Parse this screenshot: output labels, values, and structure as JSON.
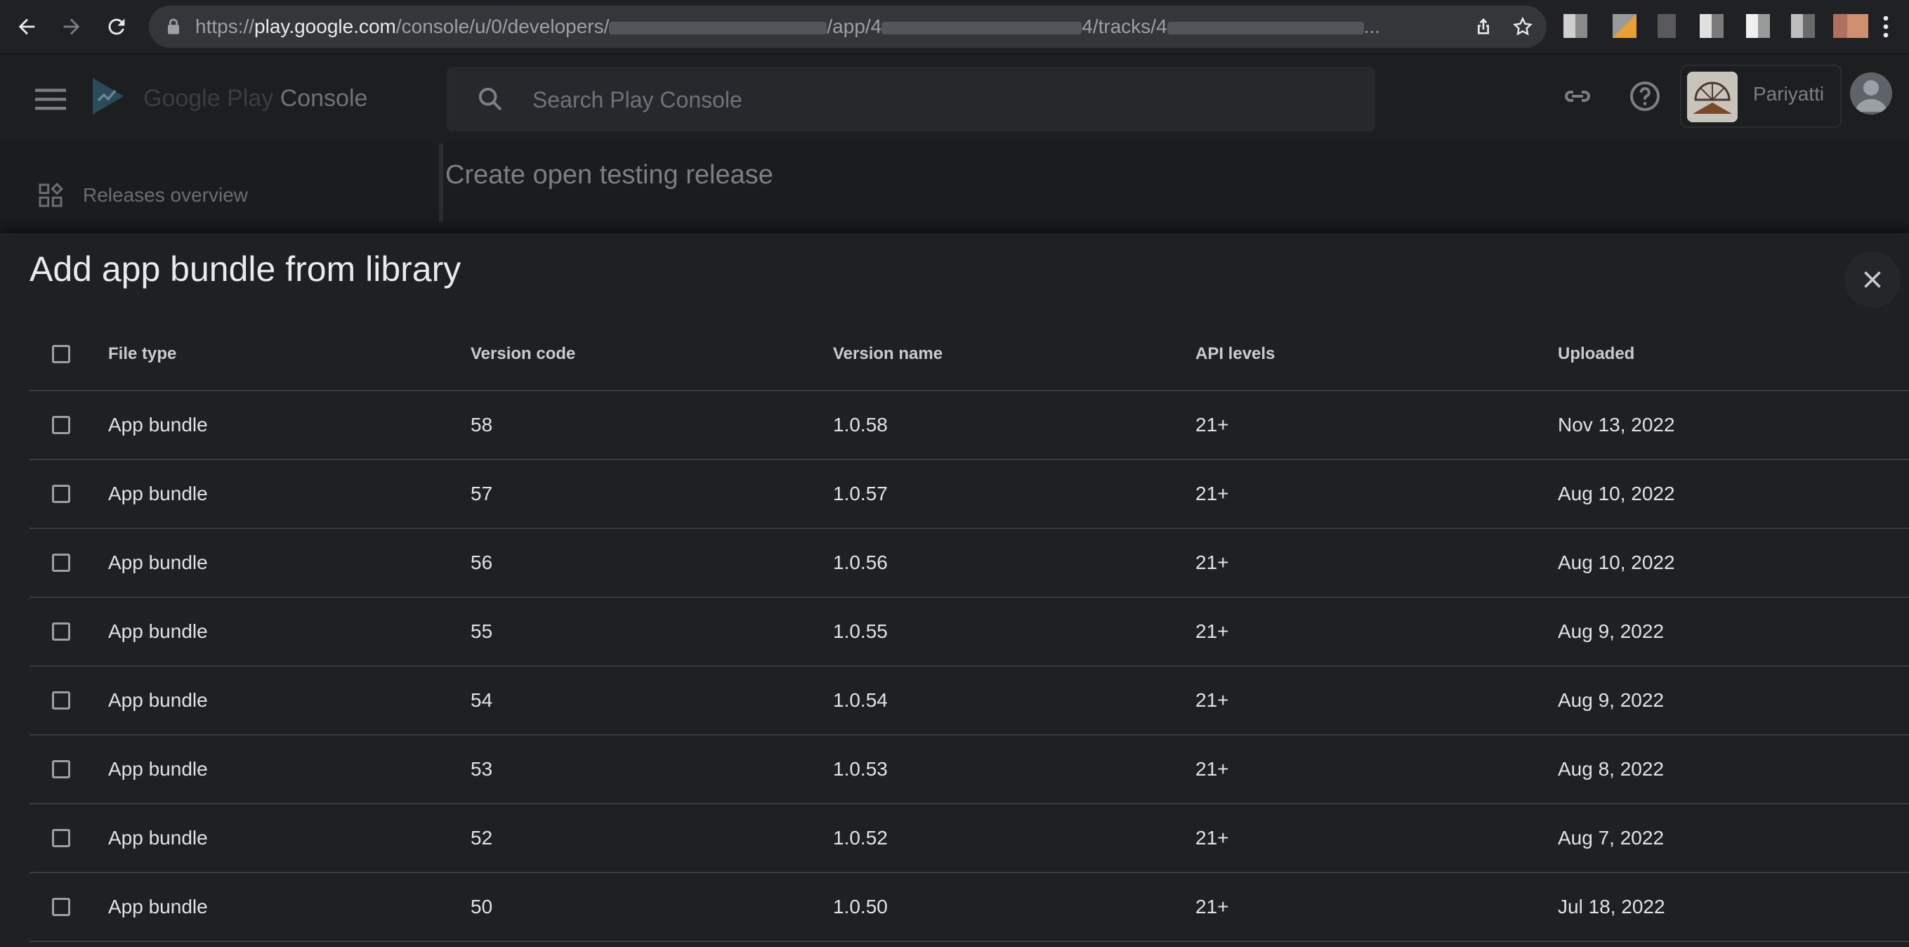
{
  "browser": {
    "url_scheme": "https://",
    "url_host": "play.google.com",
    "url_path_1": "/console/u/0/developers/",
    "url_path_2": "/app/4",
    "url_path_3": "4/tracks/4",
    "url_ellipsis": "..."
  },
  "header": {
    "brand_google_play": "Google Play",
    "brand_console": "Console",
    "search_placeholder": "Search Play Console",
    "account_name": "Pariyatti"
  },
  "sidebar": {
    "items": [
      {
        "label": "Releases overview",
        "icon": "dashboard-icon"
      }
    ]
  },
  "page": {
    "title": "Create open testing release"
  },
  "modal": {
    "title": "Add app bundle from library",
    "columns": [
      "File type",
      "Version code",
      "Version name",
      "API levels",
      "Uploaded"
    ],
    "rows": [
      {
        "file_type": "App bundle",
        "version_code": "58",
        "version_name": "1.0.58",
        "api_levels": "21+",
        "uploaded": "Nov 13, 2022"
      },
      {
        "file_type": "App bundle",
        "version_code": "57",
        "version_name": "1.0.57",
        "api_levels": "21+",
        "uploaded": "Aug 10, 2022"
      },
      {
        "file_type": "App bundle",
        "version_code": "56",
        "version_name": "1.0.56",
        "api_levels": "21+",
        "uploaded": "Aug 10, 2022"
      },
      {
        "file_type": "App bundle",
        "version_code": "55",
        "version_name": "1.0.55",
        "api_levels": "21+",
        "uploaded": "Aug 9, 2022"
      },
      {
        "file_type": "App bundle",
        "version_code": "54",
        "version_name": "1.0.54",
        "api_levels": "21+",
        "uploaded": "Aug 9, 2022"
      },
      {
        "file_type": "App bundle",
        "version_code": "53",
        "version_name": "1.0.53",
        "api_levels": "21+",
        "uploaded": "Aug 8, 2022"
      },
      {
        "file_type": "App bundle",
        "version_code": "52",
        "version_name": "1.0.52",
        "api_levels": "21+",
        "uploaded": "Aug 7, 2022"
      },
      {
        "file_type": "App bundle",
        "version_code": "50",
        "version_name": "1.0.50",
        "api_levels": "21+",
        "uploaded": "Jul 18, 2022"
      }
    ]
  }
}
